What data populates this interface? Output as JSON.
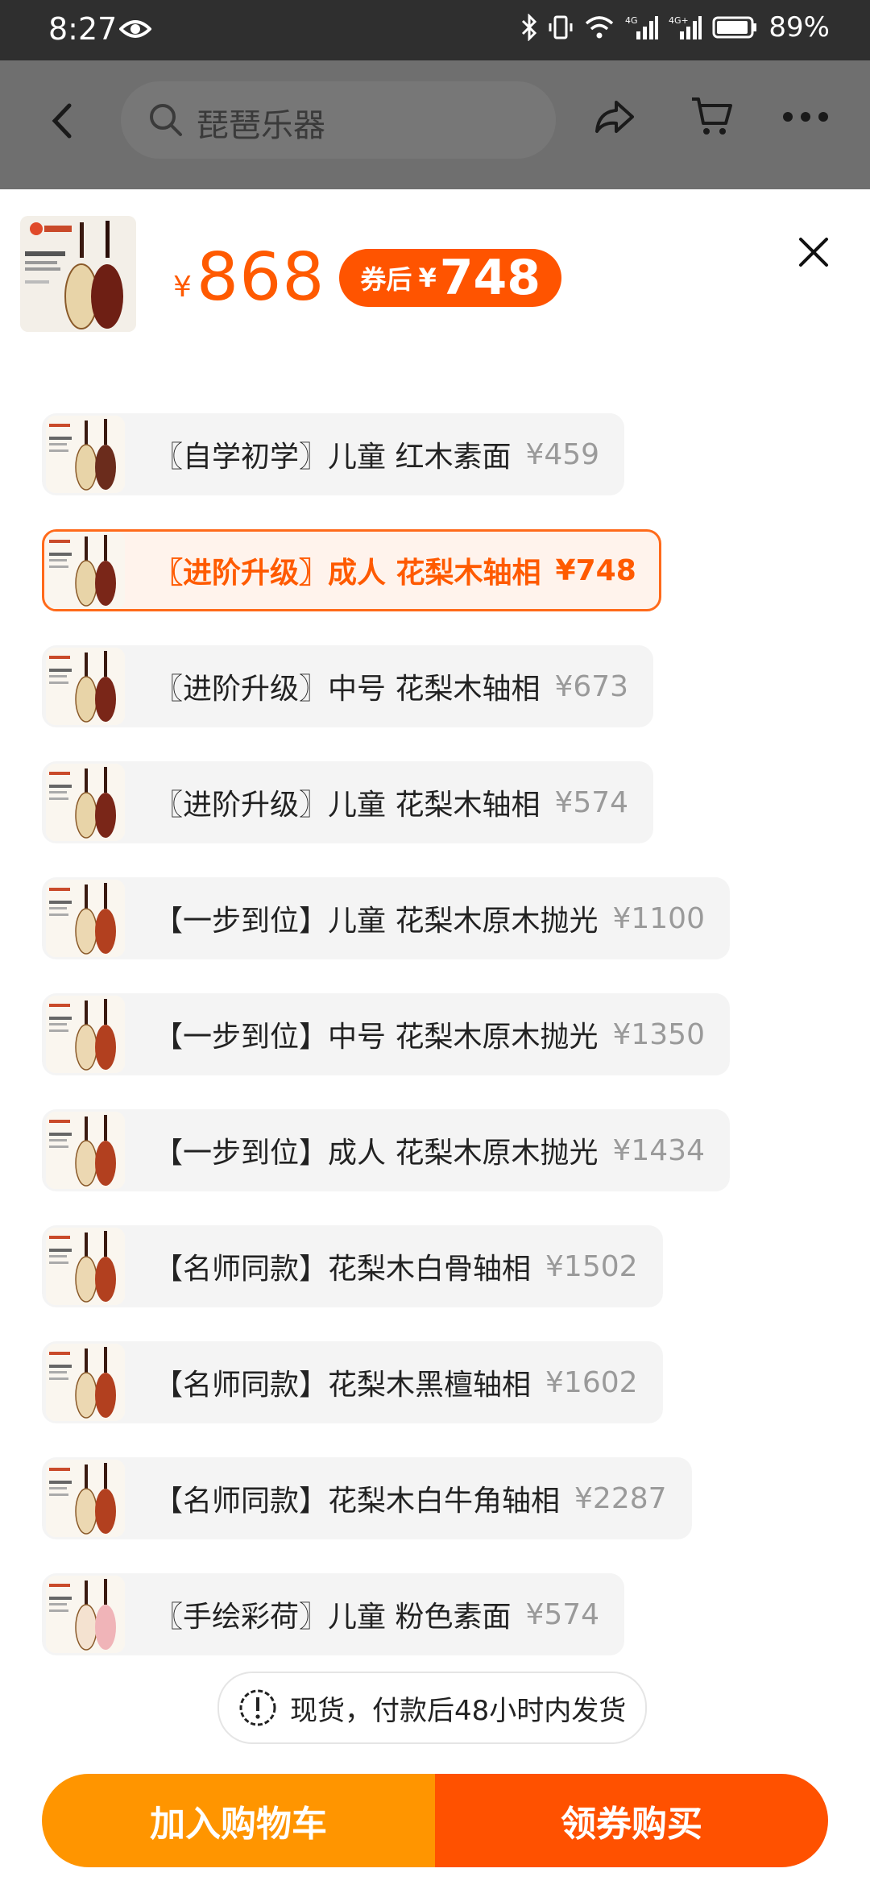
{
  "status_bar": {
    "time": "8:27",
    "battery": "89%",
    "net1": "4G",
    "net2": "4G+"
  },
  "header": {
    "search_placeholder": "琵琶乐器"
  },
  "product": {
    "price_symbol": "¥",
    "price": "868",
    "coupon_label": "券后",
    "coupon_symbol": "¥",
    "coupon_price": "748"
  },
  "options": [
    {
      "label": "〖自学初学〗儿童 红木素面",
      "price": "¥459",
      "selected": false,
      "neck": "#6b2c1c",
      "face": "#e8d4a8"
    },
    {
      "label": "〖进阶升级〗成人 花梨木轴相",
      "price": "¥748",
      "selected": true,
      "neck": "#7a2618",
      "face": "#e8d4a8"
    },
    {
      "label": "〖进阶升级〗中号 花梨木轴相",
      "price": "¥673",
      "selected": false,
      "neck": "#7a2618",
      "face": "#e8d4a8"
    },
    {
      "label": "〖进阶升级〗儿童 花梨木轴相",
      "price": "¥574",
      "selected": false,
      "neck": "#7a2618",
      "face": "#e8d4a8"
    },
    {
      "label": "【一步到位】儿童 花梨木原木抛光",
      "price": "¥1100",
      "selected": false,
      "neck": "#b2401f",
      "face": "#ecd8b2"
    },
    {
      "label": "【一步到位】中号 花梨木原木抛光",
      "price": "¥1350",
      "selected": false,
      "neck": "#b2401f",
      "face": "#ecd8b2"
    },
    {
      "label": "【一步到位】成人 花梨木原木抛光",
      "price": "¥1434",
      "selected": false,
      "neck": "#b2401f",
      "face": "#ecd8b2"
    },
    {
      "label": "【名师同款】花梨木白骨轴相",
      "price": "¥1502",
      "selected": false,
      "neck": "#b2401f",
      "face": "#ecd8b2"
    },
    {
      "label": "【名师同款】花梨木黑檀轴相",
      "price": "¥1602",
      "selected": false,
      "neck": "#b2401f",
      "face": "#ecd8b2"
    },
    {
      "label": "【名师同款】花梨木白牛角轴相",
      "price": "¥2287",
      "selected": false,
      "neck": "#b2401f",
      "face": "#ecd8b2"
    },
    {
      "label": "〖手绘彩荷〗儿童 粉色素面",
      "price": "¥574",
      "selected": false,
      "neck": "#f0b4b8",
      "face": "#f4e2d0"
    }
  ],
  "notice": {
    "text": "现货，付款后48小时内发货"
  },
  "actions": {
    "add_cart": "加入购物车",
    "buy": "领券购买"
  },
  "colors": {
    "accent": "#ff5a00",
    "cart_button": "#ff9500",
    "buy_button": "#ff5100"
  }
}
